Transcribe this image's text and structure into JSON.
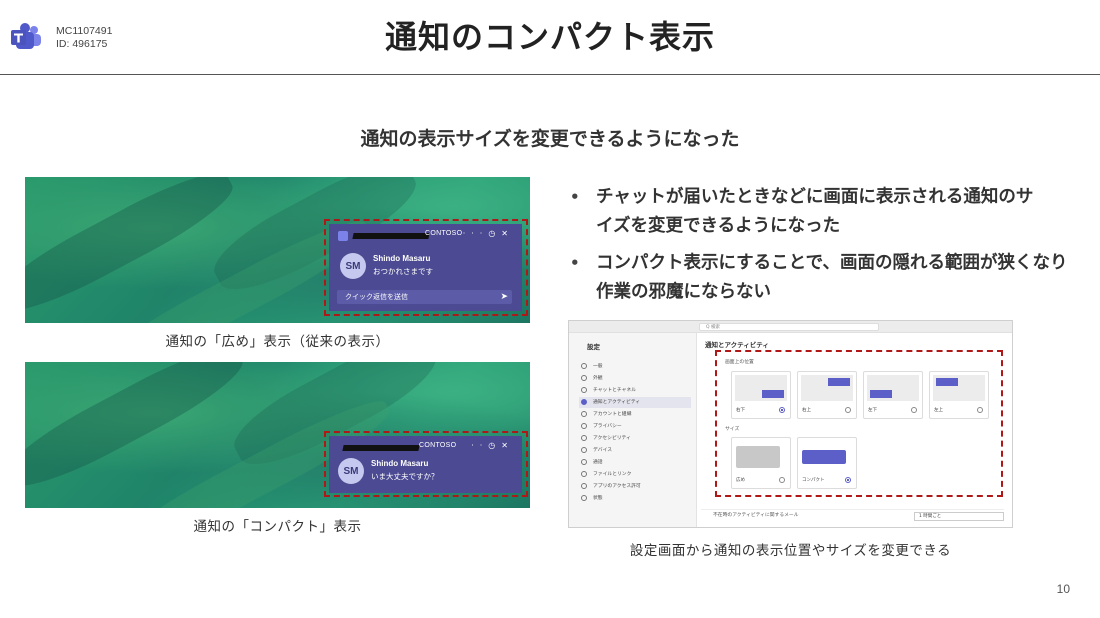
{
  "header": {
    "mc_id": "MC1107491",
    "id_line": "ID: 496175",
    "title": "通知のコンパクト表示"
  },
  "subtitle": "通知の表示サイズを変更できるようになった",
  "notification_wide": {
    "org": "CONTOSO",
    "initials": "SM",
    "sender": "Shindo Masaru",
    "message": "おつかれさまです",
    "reply_placeholder": "クイック返信を送信"
  },
  "notification_compact": {
    "org": "CONTOSO",
    "initials": "SM",
    "sender": "Shindo Masaru",
    "message": "いま大丈夫ですか？"
  },
  "captions": {
    "wide": "通知の「広め」表示（従来の表示）",
    "compact": "通知の「コンパクト」表示",
    "settings": "設定画面から通知の表示位置やサイズを変更できる"
  },
  "bullets": [
    "チャットが届いたときなどに画面に表示される通知のサイズを変更できるようになった",
    "コンパクト表示にすることで、画面の隠れる範囲が狭くなり作業の邪魔にならない"
  ],
  "settings_screen": {
    "search_placeholder": "Q 検索",
    "sidebar_title": "設定",
    "sidebar_items": [
      "一般",
      "外観",
      "チャットとチャネル",
      "通知とアクティビティ",
      "アカウントと組織",
      "プライバシー",
      "アクセシビリティ",
      "デバイス",
      "通話",
      "ファイルとリンク",
      "アプリのアクセス許可",
      "状態"
    ],
    "main_title": "通知とアクティビティ",
    "position_label": "画面上の位置",
    "positions": [
      "右下",
      "右上",
      "左下",
      "左上"
    ],
    "size_label": "サイズ",
    "sizes": [
      "広め",
      "コンパクト"
    ],
    "footer_label": "不在時のアクティビティに関するメール",
    "footer_value": "1 時間ごと"
  },
  "page_number": "10",
  "colors": {
    "notification_bg": "#4b4a92",
    "highlight_dash": "#b01818",
    "teams_purple": "#5b5fc7"
  }
}
